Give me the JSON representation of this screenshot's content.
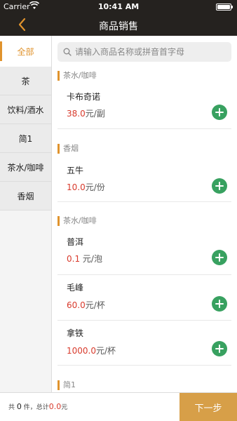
{
  "status_bar": {
    "carrier": "Carrier",
    "time": "10:41 AM"
  },
  "nav": {
    "title": "商品销售"
  },
  "sidebar": {
    "items": [
      {
        "label": "全部",
        "active": true
      },
      {
        "label": "茶"
      },
      {
        "label": "饮料/酒水"
      },
      {
        "label": "简1"
      },
      {
        "label": "茶水/咖啡"
      },
      {
        "label": "香烟"
      }
    ]
  },
  "search": {
    "placeholder": "请输入商品名称或拼音首字母"
  },
  "sections": [
    {
      "title": "茶水/咖啡"
    },
    {
      "title": "香烟"
    },
    {
      "title": "茶水/咖啡"
    },
    {
      "title": "简1"
    }
  ],
  "products": [
    {
      "name": "卡布奇诺",
      "price": "38.0",
      "unit": "元/副"
    },
    {
      "name": "五牛",
      "price": "10.0",
      "unit": "元/份"
    },
    {
      "name": "普洱",
      "price": " 0.1",
      "unit": " 元/泡"
    },
    {
      "name": "毛峰",
      "price": "60.0",
      "unit": "元/杯"
    },
    {
      "name": "拿铁",
      "price": "1000.0",
      "unit": "元/杯"
    }
  ],
  "footer": {
    "prefix": "共 ",
    "count": "0",
    "count_suffix": " 件，总计",
    "total": "0.0",
    "currency": "元",
    "next_label": "下一步"
  },
  "colors": {
    "accent": "#e0932d",
    "price": "#d83a2c",
    "add_button": "#38a160",
    "next_button": "#d79f48",
    "header": "#25221f"
  },
  "icons": [
    "wifi-icon",
    "battery-icon",
    "back-chevron-icon",
    "search-icon",
    "plus-icon"
  ]
}
